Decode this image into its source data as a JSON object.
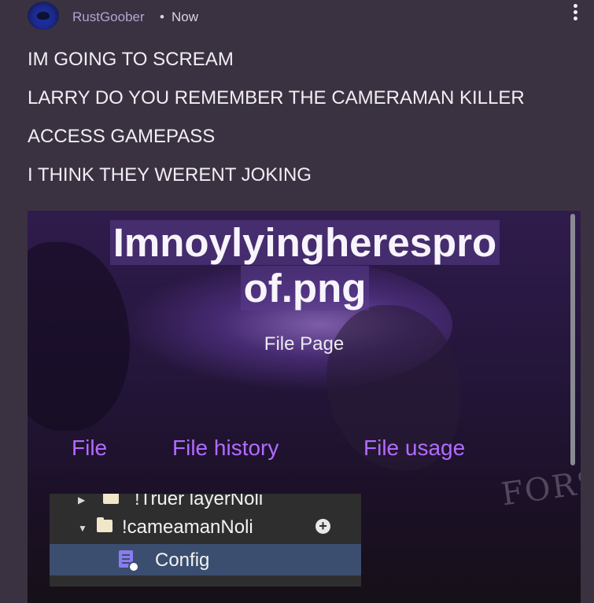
{
  "post": {
    "username": "RustGoober",
    "separator": "•",
    "time": "Now",
    "lines": [
      "IM GOING TO SCREAM",
      "LARRY DO YOU REMEMBER THE CAMERAMAN KILLER",
      "ACCESS GAMEPASS",
      "I THINK THEY WERENT JOKING"
    ]
  },
  "embed": {
    "title_line1": "Imnoylyingherespro",
    "title_line2": "of.png",
    "subtitle": "File Page",
    "tabs": [
      "File",
      "File history",
      "File usage"
    ],
    "watermark": "FORS",
    "explorer": {
      "rows": [
        {
          "label": "!Truer layerNoli"
        },
        {
          "label": "!cameamanNoli"
        },
        {
          "label": "Config"
        }
      ]
    }
  },
  "icons": {
    "more": "more-vertical-icon",
    "add": "plus-circle-icon",
    "folder": "folder-icon",
    "config": "config-script-icon"
  },
  "colors": {
    "background": "#3a3240",
    "username": "#b4a3d3",
    "tab_accent": "#b36bff",
    "selected_row": "#3b4e6f"
  }
}
